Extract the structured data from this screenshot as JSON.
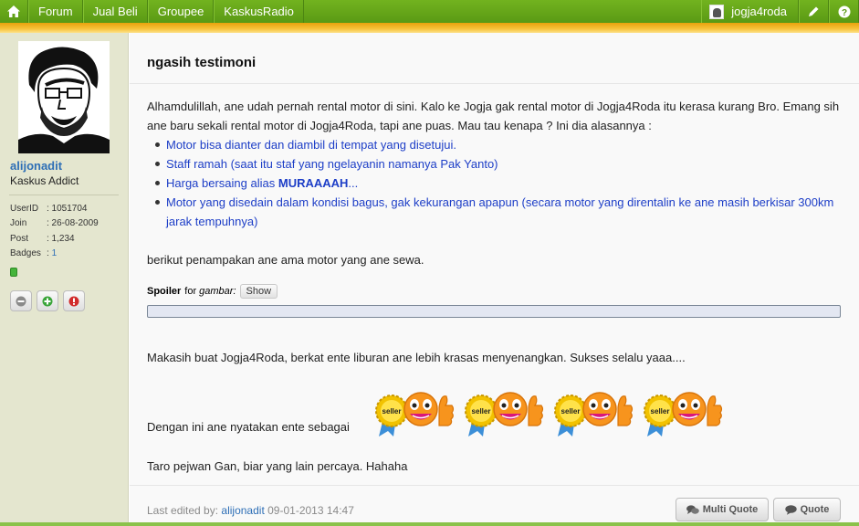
{
  "nav": {
    "home_icon": "home-icon",
    "items": [
      {
        "label": "Forum"
      },
      {
        "label": "Jual Beli"
      },
      {
        "label": "Groupee"
      },
      {
        "label": "KaskusRadio"
      }
    ],
    "username": "jogja4roda",
    "edit_icon": "pencil-icon",
    "help_icon": "help-icon"
  },
  "sidebar": {
    "username": "alijonadit",
    "rank": "Kaskus Addict",
    "stats": [
      {
        "key": "UserID",
        "value": ": 1051704"
      },
      {
        "key": "Join",
        "value": ": 26-08-2009"
      },
      {
        "key": "Post",
        "value": ": 1,234"
      },
      {
        "key": "Badges",
        "value": ": "
      }
    ],
    "badges_count": "1",
    "online_color": "#45b43a"
  },
  "post": {
    "title": "ngasih testimoni",
    "intro": "Alhamdulillah, ane udah pernah rental motor di sini. Kalo ke Jogja gak rental motor di Jogja4Roda itu kerasa kurang Bro. Emang sih ane baru sekali rental motor di Jogja4Roda, tapi ane puas. Mau tau kenapa ? Ini dia alasannya :",
    "reasons": [
      "Motor bisa dianter dan diambil di tempat yang disetujui.",
      "Staff ramah (saat itu staf yang ngelayanin namanya Pak Yanto)",
      "Motor yang disedain dalam kondisi bagus, gak kekurangan apapun (secara motor yang direntalin ke ane masih berkisar 300km jarak tempuhnya)"
    ],
    "price_prefix": "Harga bersaing alias ",
    "price_bold": "MURAAAAH",
    "price_suffix": "...",
    "photo_line": "berikut penampakan ane ama motor yang ane sewa.",
    "spoiler_label": "Spoiler",
    "spoiler_for": "for",
    "spoiler_topic": "gambar",
    "spoiler_colon": ":",
    "spoiler_button": "Show",
    "thanks": "Makasih buat Jogja4Roda, berkat ente liburan ane lebih krasas menyenangkan. Sukses selalu yaaa....",
    "declare": "Dengan ini ane nyatakan ente sebagai",
    "seller_badge_text": "seller",
    "seller_badge_count": 4,
    "taro": "Taro pejwan Gan, biar yang lain percaya. Hahaha"
  },
  "footer": {
    "edited_prefix": "Last edited by:",
    "edited_user": "alijonadit",
    "edited_time": "09-01-2013 14:47",
    "multi_quote": "Multi Quote",
    "quote": "Quote"
  },
  "colors": {
    "nav_green": "#5a9a14",
    "accent_orange": "#f0ad1c",
    "link_blue": "#2e6fb6",
    "list_blue": "#1d3ec7"
  }
}
